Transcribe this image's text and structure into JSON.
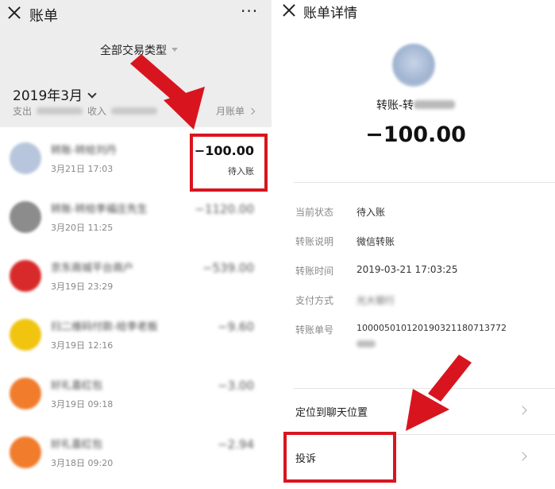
{
  "left": {
    "topbar": {
      "title": "账单",
      "more": "···"
    },
    "filter": {
      "label": "全部交易类型"
    },
    "month": {
      "label": "2019年3月"
    },
    "summary": {
      "expense_label": "支出",
      "income_label": "收入",
      "bill_link": "月账单"
    },
    "transactions": [
      {
        "title": "转账-转给刘丹",
        "time": "3月21日 17:03",
        "amount": "−100.00",
        "status": "待入账",
        "avatar_color": "#b8c6dd"
      },
      {
        "title": "转账-转给李福庄先生",
        "time": "3月20日 11:25",
        "amount": "−1120.00",
        "status": "",
        "avatar_color": "#8c8c8c"
      },
      {
        "title": "京东商城平台商户",
        "time": "3月19日 23:29",
        "amount": "−539.00",
        "status": "",
        "avatar_color": "#d82a2a"
      },
      {
        "title": "扫二维码付款-给李老板",
        "time": "3月19日 12:16",
        "amount": "−9.60",
        "status": "",
        "avatar_color": "#f1c40f"
      },
      {
        "title": "好礼喜红包",
        "time": "3月19日 09:18",
        "amount": "−3.00",
        "status": "",
        "avatar_color": "#f07c2c"
      },
      {
        "title": "好礼喜红包",
        "time": "3月18日 09:20",
        "amount": "−2.94",
        "status": "",
        "avatar_color": "#f07c2c"
      }
    ]
  },
  "right": {
    "topbar": {
      "title": "账单详情"
    },
    "name_prefix": "转账-转",
    "amount": "−100.00",
    "details": [
      {
        "label": "当前状态",
        "value": "待入账",
        "blurred": false
      },
      {
        "label": "转账说明",
        "value": "微信转账",
        "blurred": false
      },
      {
        "label": "转账时间",
        "value": "2019-03-21 17:03:25",
        "blurred": false
      },
      {
        "label": "支付方式",
        "value": "光大银行",
        "blurred": true
      },
      {
        "label": "转账单号",
        "value": "100005010120190321180713772",
        "blurred": false
      }
    ],
    "actions": {
      "locate": "定位到聊天位置",
      "complain": "投诉"
    }
  },
  "colors": {
    "highlight": "#d8151f",
    "panel_top_bg": "#ededed"
  }
}
